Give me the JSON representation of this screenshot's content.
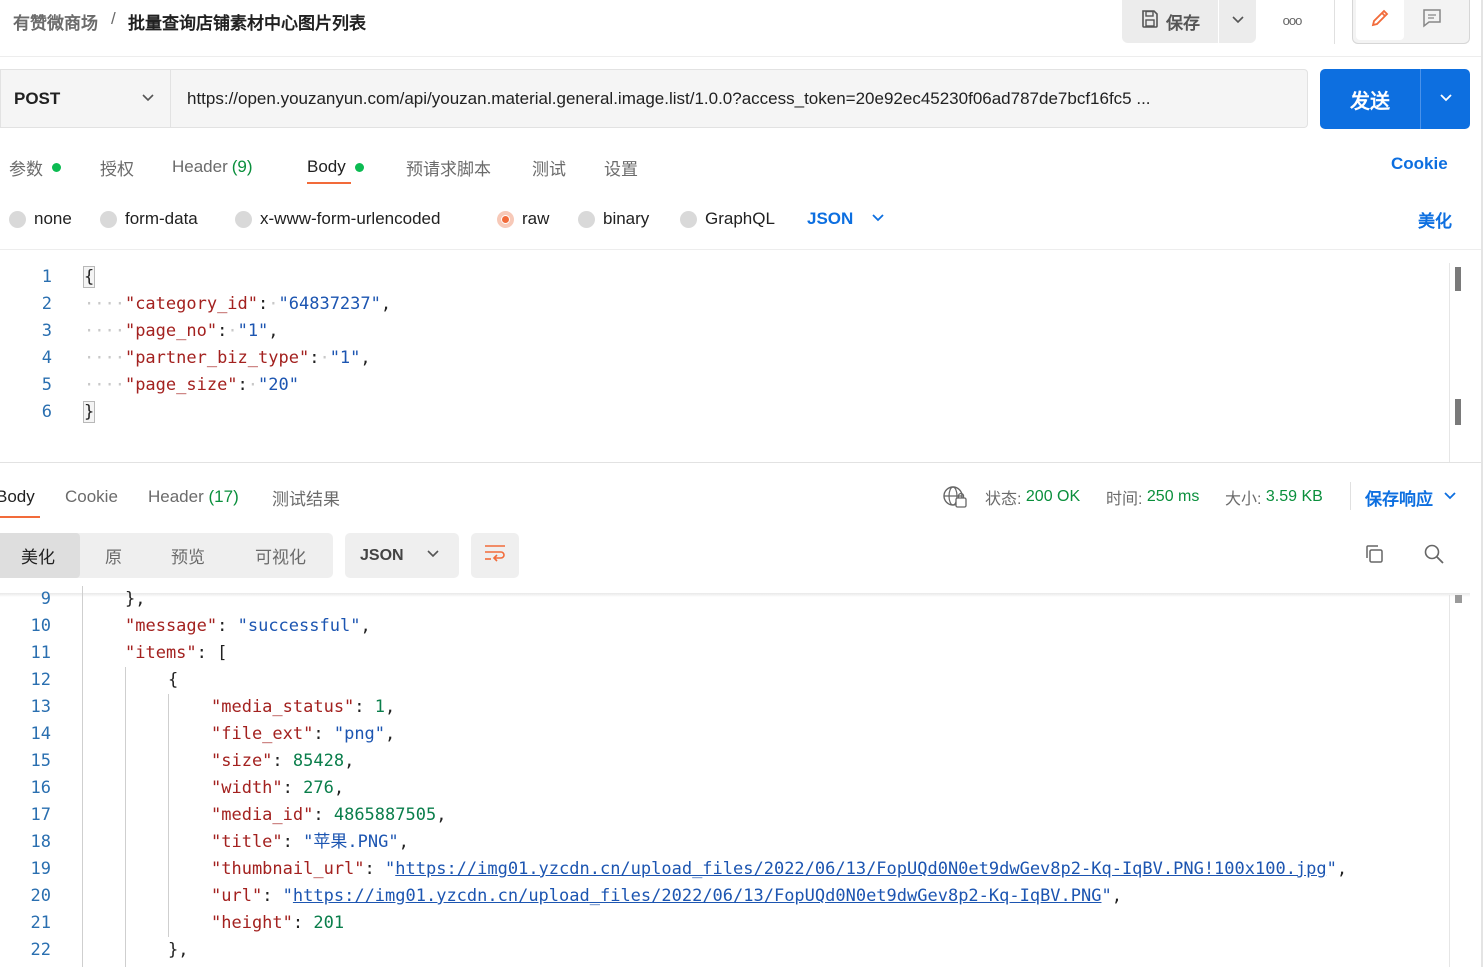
{
  "breadcrumb": {
    "parent": "有赞微商场",
    "separator": "/",
    "title": "批量查询店铺素材中心图片列表"
  },
  "header": {
    "save_label": "保存",
    "more_label": "ooo"
  },
  "request": {
    "method": "POST",
    "url": "https://open.youzanyun.com/api/youzan.material.general.image.list/1.0.0?access_token=20e92ec45230f06ad787de7bcf16fc5 ...",
    "send_label": "发送"
  },
  "request_tabs": {
    "params": "参数",
    "auth": "授权",
    "header": "Header",
    "header_count": "(9)",
    "body": "Body",
    "pre_script": "预请求脚本",
    "tests": "测试",
    "settings": "设置",
    "cookie": "Cookie"
  },
  "body_types": {
    "none": "none",
    "form_data": "form-data",
    "urlencoded": "x-www-form-urlencoded",
    "raw": "raw",
    "binary": "binary",
    "graphql": "GraphQL",
    "format": "JSON",
    "beautify": "美化"
  },
  "request_body": {
    "line_numbers": [
      "1",
      "2",
      "3",
      "4",
      "5",
      "6"
    ],
    "open_brace": "{",
    "close_brace": "}",
    "fields": [
      {
        "key": "\"category_id\"",
        "value": "\"64837237\"",
        "comma": ","
      },
      {
        "key": "\"page_no\"",
        "value": "\"1\"",
        "comma": ","
      },
      {
        "key": "\"partner_biz_type\"",
        "value": "\"1\"",
        "comma": ","
      },
      {
        "key": "\"page_size\"",
        "value": "\"20\"",
        "comma": ""
      }
    ]
  },
  "response_tabs": {
    "body": "Body",
    "cookie": "Cookie",
    "header": "Header",
    "header_count": "(17)",
    "test_results": "测试结果"
  },
  "response_status": {
    "status_label": "状态:",
    "status_value": "200 OK",
    "time_label": "时间:",
    "time_value": "250 ms",
    "size_label": "大小:",
    "size_value": "3.59 KB",
    "save_response": "保存响应"
  },
  "response_views": {
    "pretty": "美化",
    "raw": "原",
    "preview": "预览",
    "visualize": "可视化",
    "format": "JSON"
  },
  "response_body": {
    "line_numbers": [
      "9",
      "10",
      "11",
      "12",
      "13",
      "14",
      "15",
      "16",
      "17",
      "18",
      "19",
      "20",
      "21",
      "22"
    ],
    "line9": "},",
    "message_key": "\"message\"",
    "message_value": "\"successful\"",
    "items_key": "\"items\"",
    "open_bracket": "[",
    "open_brace": "{",
    "close_brace": "},",
    "media_status_key": "\"media_status\"",
    "media_status_value": "1",
    "file_ext_key": "\"file_ext\"",
    "file_ext_value": "\"png\"",
    "size_key": "\"size\"",
    "size_value": "85428",
    "width_key": "\"width\"",
    "width_value": "276",
    "media_id_key": "\"media_id\"",
    "media_id_value": "4865887505",
    "title_key": "\"title\"",
    "title_value": "\"苹果.PNG\"",
    "thumbnail_url_key": "\"thumbnail_url\"",
    "thumbnail_url_value": "https://img01.yzcdn.cn/upload_files/2022/06/13/FopUQd0N0et9dwGev8p2-Kq-IqBV.PNG!100x100.jpg",
    "url_key": "\"url\"",
    "url_value": "https://img01.yzcdn.cn/upload_files/2022/06/13/FopUQd0N0et9dwGev8p2-Kq-IqBV.PNG",
    "height_key": "\"height\"",
    "height_value": "201"
  },
  "colors": {
    "accent": "#0d6fe0",
    "active_tab": "#f26b3a",
    "status_green": "#0a8f3c"
  }
}
